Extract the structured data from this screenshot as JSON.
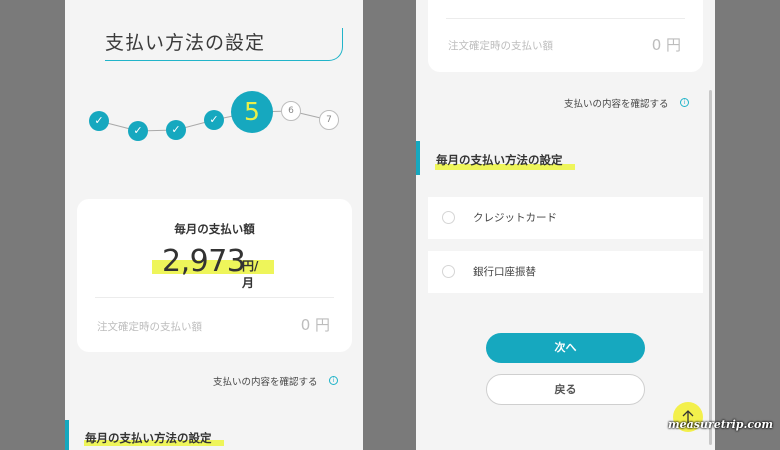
{
  "left": {
    "title": "支払い方法の設定",
    "stepper": {
      "current": "5",
      "done_mark": "✓",
      "future": [
        "6",
        "7"
      ]
    },
    "card": {
      "label": "毎月の支払い額",
      "amount": "2,973",
      "unit": "円/月",
      "order_label": "注文確定時の支払い額",
      "order_value": "0 円"
    },
    "confirm_link": "支払いの内容を確認する",
    "section_heading": "毎月の支払い方法の設定"
  },
  "right": {
    "top_card": {
      "order_label": "注文確定時の支払い額",
      "order_value": "0 円"
    },
    "confirm_link": "支払いの内容を確認する",
    "section_heading": "毎月の支払い方法の設定",
    "options": [
      "クレジットカード",
      "銀行口座振替"
    ],
    "next_button": "次へ",
    "back_button": "戻る"
  },
  "watermark": "measuretrip.com",
  "colors": {
    "accent": "#16a8bf",
    "highlight": "#eef55a",
    "background": "#f4f4f4",
    "frame": "#7a7a7a"
  },
  "icons": {
    "step_done": "check-icon",
    "info": "info-circle-icon",
    "scroll_top": "arrow-up-icon"
  }
}
